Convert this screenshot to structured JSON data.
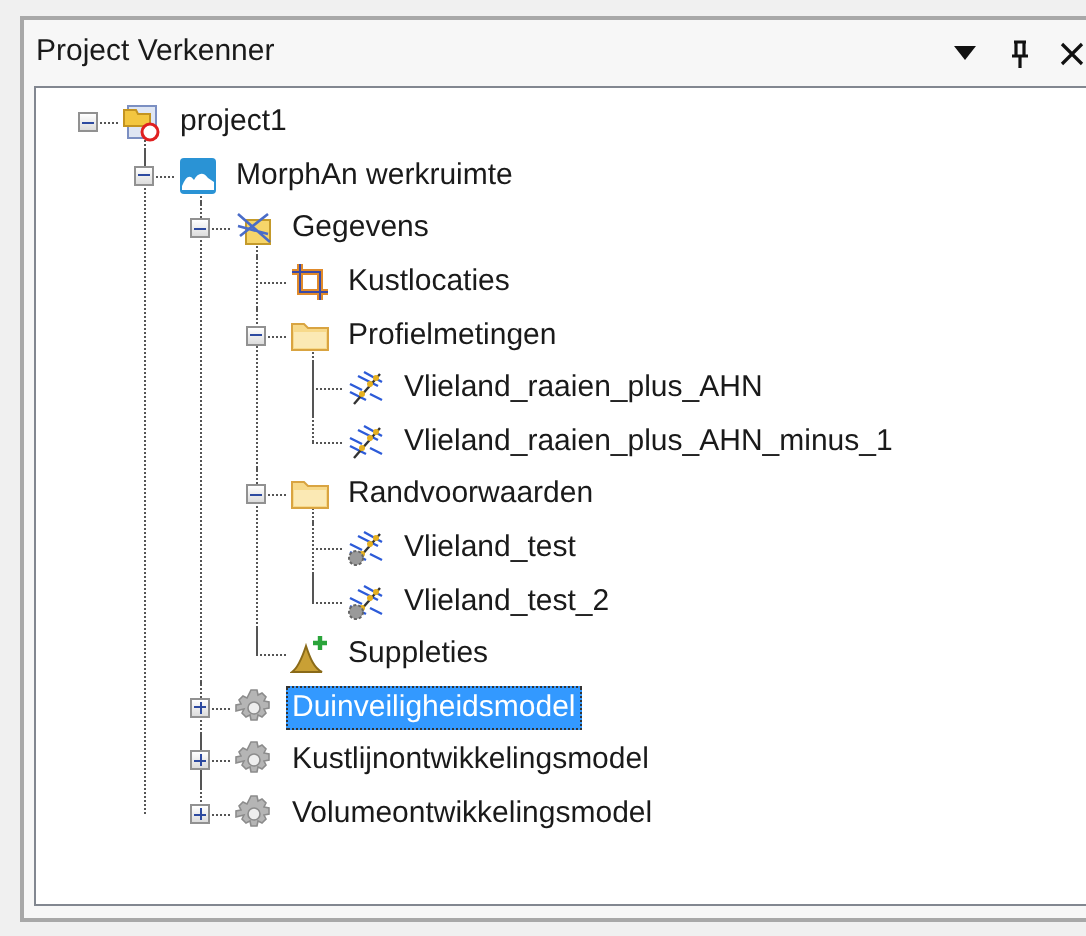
{
  "panel": {
    "title": "Project Verkenner"
  },
  "tree": [
    {
      "label": "project1",
      "kind": "project",
      "expanded": true,
      "selected": false,
      "children": [
        {
          "label": "MorphAn werkruimte",
          "kind": "workspace",
          "expanded": true,
          "selected": false,
          "children": [
            {
              "label": "Gegevens",
              "kind": "data",
              "expanded": true,
              "selected": false,
              "children": [
                {
                  "label": "Kustlocaties",
                  "kind": "crop",
                  "selected": false
                },
                {
                  "label": "Profielmetingen",
                  "kind": "folder",
                  "expanded": true,
                  "selected": false,
                  "children": [
                    {
                      "label": "Vlieland_raaien_plus_AHN",
                      "kind": "profile",
                      "selected": false
                    },
                    {
                      "label": "Vlieland_raaien_plus_AHN_minus_1",
                      "kind": "profile",
                      "selected": false
                    }
                  ]
                },
                {
                  "label": "Randvoorwaarden",
                  "kind": "folder",
                  "expanded": true,
                  "selected": false,
                  "children": [
                    {
                      "label": "Vlieland_test",
                      "kind": "profile-gear",
                      "selected": false
                    },
                    {
                      "label": "Vlieland_test_2",
                      "kind": "profile-gear",
                      "selected": false
                    }
                  ]
                },
                {
                  "label": "Suppleties",
                  "kind": "nourishment",
                  "selected": false
                }
              ]
            },
            {
              "label": "Duinveiligheidsmodel",
              "kind": "model",
              "expanded": false,
              "selected": true
            },
            {
              "label": "Kustlijnontwikkelingsmodel",
              "kind": "model",
              "expanded": false,
              "selected": false
            },
            {
              "label": "Volumeontwikkelingsmodel",
              "kind": "model",
              "expanded": false,
              "selected": false
            }
          ]
        }
      ]
    }
  ]
}
